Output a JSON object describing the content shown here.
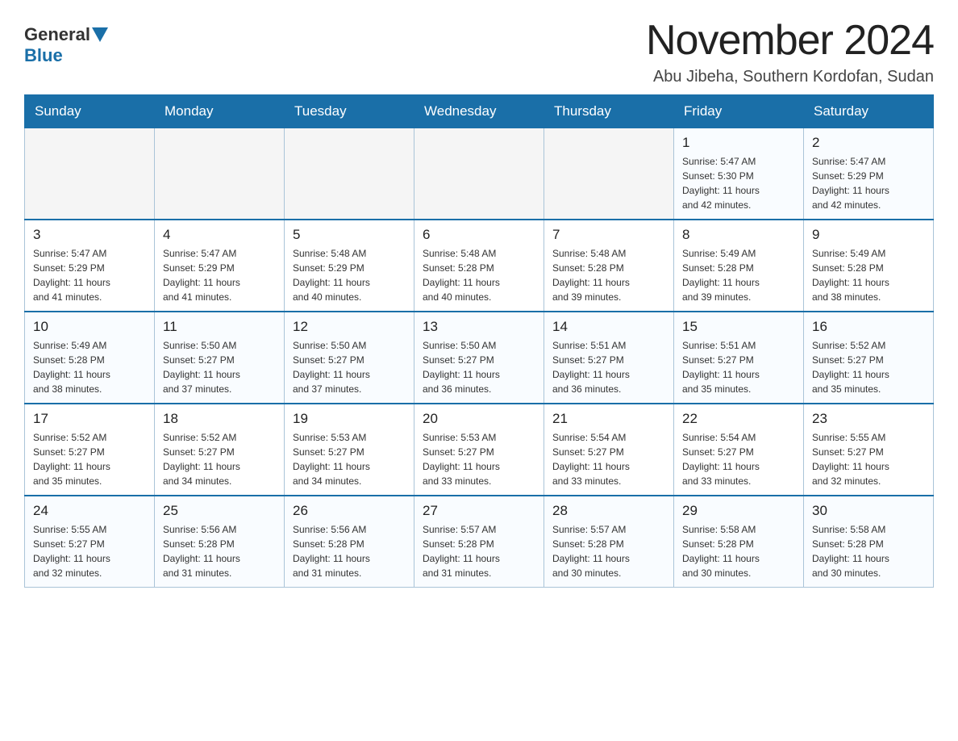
{
  "header": {
    "logo_general": "General",
    "logo_blue": "Blue",
    "month_title": "November 2024",
    "location": "Abu Jibeha, Southern Kordofan, Sudan"
  },
  "weekdays": [
    "Sunday",
    "Monday",
    "Tuesday",
    "Wednesday",
    "Thursday",
    "Friday",
    "Saturday"
  ],
  "weeks": [
    [
      {
        "day": "",
        "info": ""
      },
      {
        "day": "",
        "info": ""
      },
      {
        "day": "",
        "info": ""
      },
      {
        "day": "",
        "info": ""
      },
      {
        "day": "",
        "info": ""
      },
      {
        "day": "1",
        "info": "Sunrise: 5:47 AM\nSunset: 5:30 PM\nDaylight: 11 hours\nand 42 minutes."
      },
      {
        "day": "2",
        "info": "Sunrise: 5:47 AM\nSunset: 5:29 PM\nDaylight: 11 hours\nand 42 minutes."
      }
    ],
    [
      {
        "day": "3",
        "info": "Sunrise: 5:47 AM\nSunset: 5:29 PM\nDaylight: 11 hours\nand 41 minutes."
      },
      {
        "day": "4",
        "info": "Sunrise: 5:47 AM\nSunset: 5:29 PM\nDaylight: 11 hours\nand 41 minutes."
      },
      {
        "day": "5",
        "info": "Sunrise: 5:48 AM\nSunset: 5:29 PM\nDaylight: 11 hours\nand 40 minutes."
      },
      {
        "day": "6",
        "info": "Sunrise: 5:48 AM\nSunset: 5:28 PM\nDaylight: 11 hours\nand 40 minutes."
      },
      {
        "day": "7",
        "info": "Sunrise: 5:48 AM\nSunset: 5:28 PM\nDaylight: 11 hours\nand 39 minutes."
      },
      {
        "day": "8",
        "info": "Sunrise: 5:49 AM\nSunset: 5:28 PM\nDaylight: 11 hours\nand 39 minutes."
      },
      {
        "day": "9",
        "info": "Sunrise: 5:49 AM\nSunset: 5:28 PM\nDaylight: 11 hours\nand 38 minutes."
      }
    ],
    [
      {
        "day": "10",
        "info": "Sunrise: 5:49 AM\nSunset: 5:28 PM\nDaylight: 11 hours\nand 38 minutes."
      },
      {
        "day": "11",
        "info": "Sunrise: 5:50 AM\nSunset: 5:27 PM\nDaylight: 11 hours\nand 37 minutes."
      },
      {
        "day": "12",
        "info": "Sunrise: 5:50 AM\nSunset: 5:27 PM\nDaylight: 11 hours\nand 37 minutes."
      },
      {
        "day": "13",
        "info": "Sunrise: 5:50 AM\nSunset: 5:27 PM\nDaylight: 11 hours\nand 36 minutes."
      },
      {
        "day": "14",
        "info": "Sunrise: 5:51 AM\nSunset: 5:27 PM\nDaylight: 11 hours\nand 36 minutes."
      },
      {
        "day": "15",
        "info": "Sunrise: 5:51 AM\nSunset: 5:27 PM\nDaylight: 11 hours\nand 35 minutes."
      },
      {
        "day": "16",
        "info": "Sunrise: 5:52 AM\nSunset: 5:27 PM\nDaylight: 11 hours\nand 35 minutes."
      }
    ],
    [
      {
        "day": "17",
        "info": "Sunrise: 5:52 AM\nSunset: 5:27 PM\nDaylight: 11 hours\nand 35 minutes."
      },
      {
        "day": "18",
        "info": "Sunrise: 5:52 AM\nSunset: 5:27 PM\nDaylight: 11 hours\nand 34 minutes."
      },
      {
        "day": "19",
        "info": "Sunrise: 5:53 AM\nSunset: 5:27 PM\nDaylight: 11 hours\nand 34 minutes."
      },
      {
        "day": "20",
        "info": "Sunrise: 5:53 AM\nSunset: 5:27 PM\nDaylight: 11 hours\nand 33 minutes."
      },
      {
        "day": "21",
        "info": "Sunrise: 5:54 AM\nSunset: 5:27 PM\nDaylight: 11 hours\nand 33 minutes."
      },
      {
        "day": "22",
        "info": "Sunrise: 5:54 AM\nSunset: 5:27 PM\nDaylight: 11 hours\nand 33 minutes."
      },
      {
        "day": "23",
        "info": "Sunrise: 5:55 AM\nSunset: 5:27 PM\nDaylight: 11 hours\nand 32 minutes."
      }
    ],
    [
      {
        "day": "24",
        "info": "Sunrise: 5:55 AM\nSunset: 5:27 PM\nDaylight: 11 hours\nand 32 minutes."
      },
      {
        "day": "25",
        "info": "Sunrise: 5:56 AM\nSunset: 5:28 PM\nDaylight: 11 hours\nand 31 minutes."
      },
      {
        "day": "26",
        "info": "Sunrise: 5:56 AM\nSunset: 5:28 PM\nDaylight: 11 hours\nand 31 minutes."
      },
      {
        "day": "27",
        "info": "Sunrise: 5:57 AM\nSunset: 5:28 PM\nDaylight: 11 hours\nand 31 minutes."
      },
      {
        "day": "28",
        "info": "Sunrise: 5:57 AM\nSunset: 5:28 PM\nDaylight: 11 hours\nand 30 minutes."
      },
      {
        "day": "29",
        "info": "Sunrise: 5:58 AM\nSunset: 5:28 PM\nDaylight: 11 hours\nand 30 minutes."
      },
      {
        "day": "30",
        "info": "Sunrise: 5:58 AM\nSunset: 5:28 PM\nDaylight: 11 hours\nand 30 minutes."
      }
    ]
  ]
}
